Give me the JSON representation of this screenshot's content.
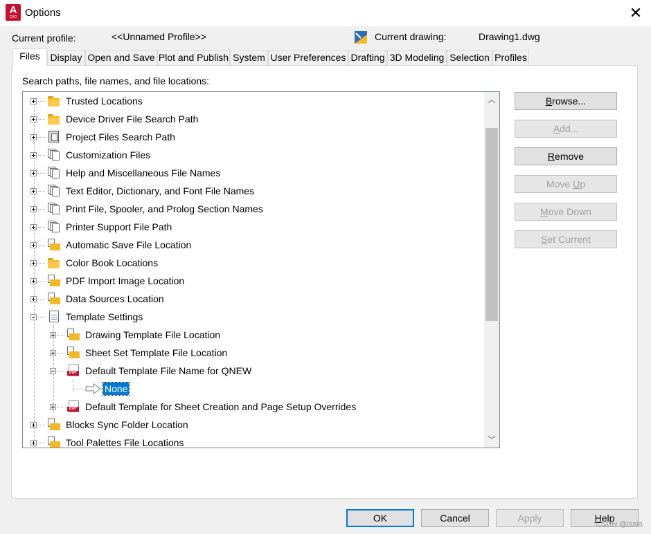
{
  "window": {
    "title": "Options",
    "app_icon_letter": "A",
    "app_icon_caption": "CAD",
    "close_glyph": "✕"
  },
  "header": {
    "profile_label": "Current profile:",
    "profile_value": "<<Unnamed Profile>>",
    "drawing_label": "Current drawing:",
    "drawing_value": "Drawing1.dwg"
  },
  "tabs": [
    {
      "label": "Files",
      "active": true
    },
    {
      "label": "Display"
    },
    {
      "label": "Open and Save"
    },
    {
      "label": "Plot and Publish"
    },
    {
      "label": "System"
    },
    {
      "label": "User Preferences"
    },
    {
      "label": "Drafting"
    },
    {
      "label": "3D Modeling"
    },
    {
      "label": "Selection"
    },
    {
      "label": "Profiles"
    }
  ],
  "files": {
    "section_label": "Search paths, file names, and file locations:",
    "tree": [
      {
        "label": "Trusted Locations",
        "icon": "folder-icon",
        "expanded": false
      },
      {
        "label": "Device Driver File Search Path",
        "icon": "folder-icon",
        "expanded": false
      },
      {
        "label": "Project Files Search Path",
        "icon": "project-icon",
        "expanded": false
      },
      {
        "label": "Customization Files",
        "icon": "documents-icon",
        "expanded": false
      },
      {
        "label": "Help and Miscellaneous File Names",
        "icon": "documents-icon",
        "expanded": false
      },
      {
        "label": "Text Editor, Dictionary, and Font File Names",
        "icon": "documents-icon",
        "expanded": false
      },
      {
        "label": "Print File, Spooler, and Prolog Section Names",
        "icon": "documents-icon",
        "expanded": false
      },
      {
        "label": "Printer Support File Path",
        "icon": "documents-icon",
        "expanded": false
      },
      {
        "label": "Automatic Save File Location",
        "icon": "folder-documents-icon",
        "expanded": false
      },
      {
        "label": "Color Book Locations",
        "icon": "folder-icon",
        "expanded": false
      },
      {
        "label": "PDF Import Image Location",
        "icon": "folder-documents-icon",
        "expanded": false
      },
      {
        "label": "Data Sources Location",
        "icon": "folder-documents-icon",
        "expanded": false
      },
      {
        "label": "Template Settings",
        "icon": "template-icon",
        "expanded": true
      },
      {
        "label": "Drawing Template File Location",
        "icon": "folder-documents-icon",
        "expanded": false
      },
      {
        "label": "Sheet Set Template File Location",
        "icon": "folder-documents-icon",
        "expanded": false
      },
      {
        "label": "Default Template File Name for QNEW",
        "icon": "dwt-file-icon",
        "expanded": true
      },
      {
        "label": "None",
        "icon": "arrow-icon",
        "selected": true
      },
      {
        "label": "Default Template for Sheet Creation and Page Setup Overrides",
        "icon": "dwt-file-icon",
        "expanded": false
      },
      {
        "label": "Blocks Sync Folder Location",
        "icon": "folder-documents-icon",
        "expanded": false
      },
      {
        "label": "Tool Palettes File Locations",
        "icon": "folder-documents-icon",
        "expanded": false
      }
    ],
    "scroll_up_glyph": "︿",
    "scroll_down_glyph": "﹀",
    "buttons": {
      "browse": {
        "pre": "",
        "key": "B",
        "post": "rowse..."
      },
      "add": {
        "pre": "",
        "key": "A",
        "post": "dd..."
      },
      "remove": {
        "pre": "",
        "key": "R",
        "post": "emove"
      },
      "move_up": {
        "pre": "Move ",
        "key": "U",
        "post": "p"
      },
      "move_down": {
        "pre": "",
        "key": "M",
        "post": "ove Down"
      },
      "set_current": {
        "pre": "",
        "key": "S",
        "post": "et Current"
      }
    }
  },
  "footer": {
    "ok": "OK",
    "cancel": "Cancel",
    "apply": "Apply",
    "help_key": "H",
    "help_rest": "elp"
  },
  "watermark": "CSDN @issta"
}
